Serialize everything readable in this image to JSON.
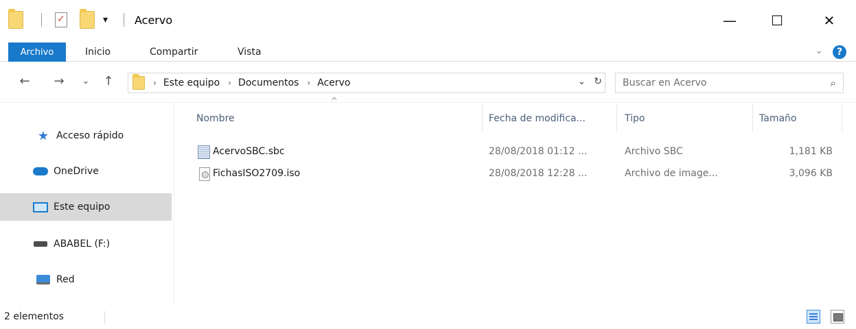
{
  "window": {
    "title": "Acervo",
    "minimize_symbol": "—",
    "maximize_symbol": "☐",
    "close_symbol": "✕",
    "qa_dropdown_symbol": "▾"
  },
  "ribbon": {
    "tabs": [
      {
        "label": "Archivo"
      },
      {
        "label": "Inicio"
      },
      {
        "label": "Compartir"
      },
      {
        "label": "Vista"
      }
    ],
    "collapse_symbol": "⌄",
    "help_symbol": "?"
  },
  "nav": {
    "back_symbol": "←",
    "forward_symbol": "→",
    "recent_symbol": "⌄",
    "up_symbol": "↑",
    "breadcrumb": [
      "Este equipo",
      "Documentos",
      "Acervo"
    ],
    "crumb_sep": "›",
    "addr_dropdown_symbol": "⌄",
    "refresh_symbol": "↻",
    "search_placeholder": "Buscar en Acervo",
    "search_symbol": "⌕"
  },
  "sidebar": {
    "items": [
      {
        "label": "Acceso rápido",
        "icon": "star-icon"
      },
      {
        "label": "OneDrive",
        "icon": "cloud-icon"
      },
      {
        "label": "Este equipo",
        "icon": "computer-icon",
        "selected": true
      },
      {
        "label": "ABABEL (F:)",
        "icon": "drive-icon"
      },
      {
        "label": "Red",
        "icon": "network-icon"
      }
    ]
  },
  "columns": {
    "name": "Nombre",
    "date": "Fecha de modifica...",
    "type": "Tipo",
    "size": "Tamaño",
    "sort_symbol": "^"
  },
  "files": [
    {
      "name": "AcervoSBC.sbc",
      "date": "28/08/2018 01:12 ...",
      "type": "Archivo SBC",
      "size": "1,181 KB",
      "icon": "text-file-icon"
    },
    {
      "name": "FichasISO2709.iso",
      "date": "28/08/2018 12:28 ...",
      "type": "Archivo de image...",
      "size": "3,096 KB",
      "icon": "disc-image-icon"
    }
  ],
  "status": {
    "count": "2 elementos"
  },
  "colors": {
    "accent": "#1979ca",
    "selected_bg": "#d9d9d9",
    "header_text": "#4c607a"
  }
}
